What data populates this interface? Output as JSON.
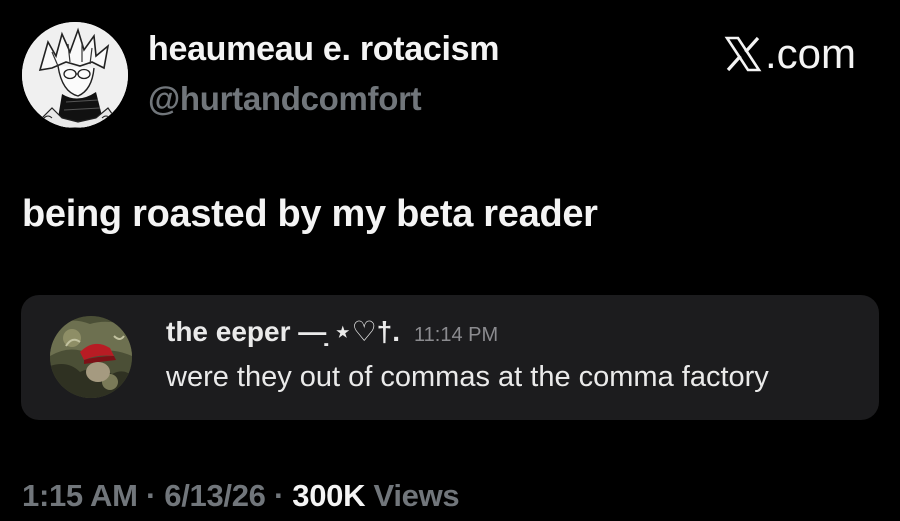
{
  "author": {
    "display_name": "heaumeau e. rotacism",
    "handle": "@hurtandcomfort",
    "avatar_icon": "anime-character-avatar-icon"
  },
  "brand": {
    "label": ".com",
    "icon": "x-logo-icon"
  },
  "tweet": {
    "text": "being roasted by my beta reader"
  },
  "quoted": {
    "name": "the eeper —̣ ⋆♡†.",
    "time": "11:14 PM",
    "text": "were they out of commas at the comma factory",
    "avatar_icon": "camo-character-avatar-icon",
    "background_color": "#1c1c1e"
  },
  "meta": {
    "time": "1:15 AM",
    "separator": " · ",
    "date": "6/13/26",
    "views_count": "300K",
    "views_label": " Views"
  },
  "colors": {
    "background": "#000000",
    "primary_text": "#f4f4f4",
    "secondary_text": "#71767b"
  }
}
